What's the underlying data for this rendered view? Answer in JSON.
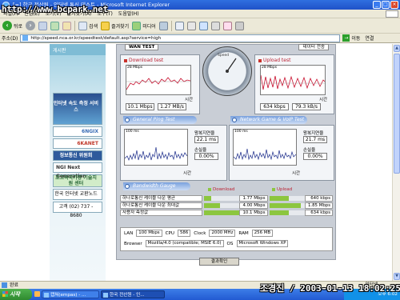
{
  "window": {
    "title": "[=] 한국 전산원 - 인터넷 통신 테스트 - Microsoft Internet Explorer",
    "watermark": "http://www.bcpark.net",
    "timestamp_overlay": "조경진 / 2003-01-13 18:02:25"
  },
  "menu": [
    "파일(F)",
    "편집(E)",
    "보기(V)",
    "즐겨찾기(A)",
    "도구(T)",
    "도움말(H)"
  ],
  "toolbar": {
    "back_label": "뒤로",
    "search_label": "검색",
    "favorites_label": "즐겨찾기",
    "media_label": "미디어"
  },
  "address": {
    "label": "주소(D)",
    "url": "http://speed.nca.or.kr/speedtest/default.asp?service=high",
    "go_label": "이동",
    "links_label": "연결"
  },
  "sidebar": {
    "header": "게시판",
    "logos": [
      "인터넷 속도 측정 서비스",
      "6NGIX",
      "6KANET",
      "정보통신 위원회",
      "NGI Next Generation",
      "초고속국가망 기술지원 센터",
      "한국 인터넷 교환노드",
      "고객 (02) 737 - 8680"
    ]
  },
  "speedtest": {
    "tab_left": "WAN TEST",
    "tab_right": "데이터 전송",
    "gauge_label": "Speed",
    "download": {
      "title": "Download test",
      "ymax_label": "28 Mbps",
      "x_label": "시간",
      "value1": "10.1 Mbps",
      "value2": "1.27 MB/s"
    },
    "upload": {
      "title": "Upload test",
      "ymax_label": "28 Mbps",
      "x_label": "시간",
      "value1": "634 kbps",
      "value2": "79.3 kB/s"
    },
    "ping": {
      "title": "General Ping Test",
      "ymax_label": "100 ms",
      "x_label": "시간",
      "avg_label": "왕복지연율",
      "avg_value": "22.1 ms",
      "loss_label": "손실율",
      "loss_value": "0.00%"
    },
    "voip": {
      "title": "Network Game & VoIP Test",
      "ymax_label": "100 ms",
      "x_label": "시간",
      "avg_label": "왕복지연율",
      "avg_value": "21.7 ms",
      "loss_label": "손실율",
      "loss_value": "0.00%"
    },
    "bandwidth": {
      "title": "Bandwidth Gauge",
      "download_header": "Download",
      "upload_header": "Upload",
      "rows": [
        {
          "name": "하나로통신 케이블 다운 평균",
          "down": "1.77 Mbps",
          "down_frac": 0.2,
          "up": "640 kbps",
          "up_frac": 0.55
        },
        {
          "name": "하나로통신 케이블 다운 최대값",
          "down": "4.00 Mbps",
          "down_frac": 0.45,
          "up": "1.85 Mbps",
          "up_frac": 0.9
        },
        {
          "name": "사용자 측정값",
          "down": "10.1 Mbps",
          "down_frac": 1.0,
          "up": "634 kbps",
          "up_frac": 0.55
        }
      ]
    },
    "system": {
      "lan_label": "LAN",
      "lan_value": "100 Mbps",
      "cpu_label": "CPU",
      "cpu_value": "586",
      "clock_label": "Clock",
      "clock_value": "2000 MHz",
      "ram_label": "RAM",
      "ram_value": "256 MB",
      "browser_label": "Browser",
      "browser_value": "Mozilla/4.0 (compatible; MSIE 6.0)",
      "os_label": "OS",
      "os_value": "Microsoft Windows XP"
    },
    "confirm_label": "결과확인"
  },
  "status": {
    "text": "완료",
    "zone": "인터넷"
  },
  "taskbar": {
    "start_label": "시작",
    "tasks": [
      "캡쳐(empas) - ...",
      "한국 전산원 - 인..."
    ],
    "clock": "오후 6:02"
  }
}
